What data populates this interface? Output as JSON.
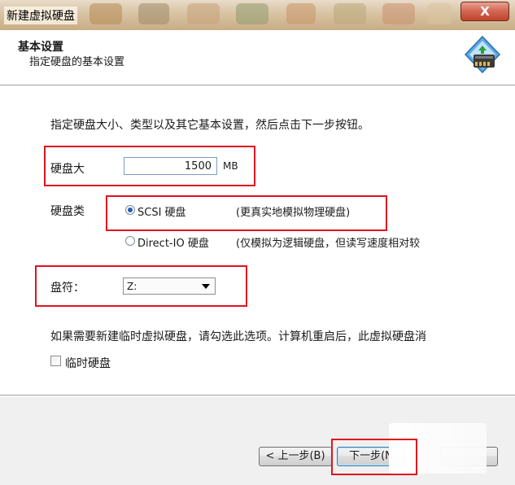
{
  "window": {
    "title": "新建虚拟硬盘",
    "close_label": "X"
  },
  "header": {
    "title": "基本设置",
    "subtitle": "指定硬盘的基本设置",
    "icon": "hard-disk-wizard-icon"
  },
  "form": {
    "intro": "指定硬盘大小、类型以及其它基本设置，然后点击下一步按钮。",
    "size_label": "硬盘大",
    "size_value": "1500",
    "size_unit": "MB",
    "type_label": "硬盘类",
    "type_options": [
      {
        "label": "SCSI 硬盘",
        "note": "(更真实地模拟物理硬盘)",
        "selected": true
      },
      {
        "label": "Direct-IO 硬盘",
        "note": "(仅模拟为逻辑硬盘，但读写速度相对较",
        "selected": false
      }
    ],
    "drive_label": "盘符：",
    "drive_value": "Z:",
    "temp_note": "如果需要新建临时虚拟硬盘，请勾选此选项。计算机重启后，此虚拟硬盘消",
    "temp_checkbox_label": "临时硬盘",
    "temp_checked": false
  },
  "footer": {
    "back_label": "< 上一步(B)",
    "next_label": "下一步(N"
  },
  "colors": {
    "highlight": "#e0141e",
    "radio_selected": "#1f5fb5",
    "footer_bg": "#f0f0f0"
  }
}
